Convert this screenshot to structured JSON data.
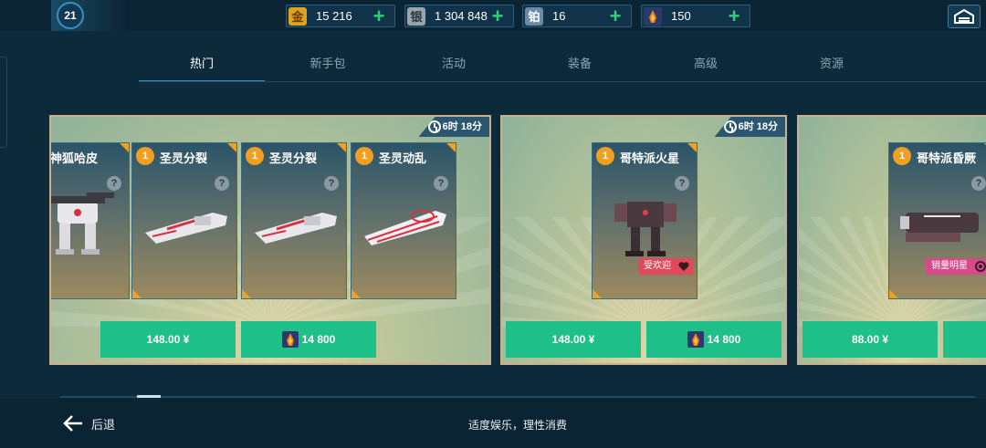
{
  "topbar": {
    "level": "21",
    "resources": [
      {
        "icon": "gold-icon",
        "glyph": "金",
        "value": "15 216",
        "color": "#e0a020"
      },
      {
        "icon": "silver-icon",
        "glyph": "银",
        "value": "1 304 848",
        "color": "#9aa4ac"
      },
      {
        "icon": "platinum-icon",
        "glyph": "铂",
        "value": "16",
        "color": "#6a8aa8"
      },
      {
        "icon": "key-token-icon",
        "glyph": "",
        "value": "150",
        "color": "#e05a30"
      }
    ],
    "home_icon": "hangar-icon"
  },
  "tabs": [
    "热门",
    "新手包",
    "活动",
    "装备",
    "高级",
    "资源"
  ],
  "active_tab": 0,
  "offers": [
    {
      "timer": "6时 18分",
      "cards": [
        {
          "qty": "",
          "name": "神狐哈皮"
        },
        {
          "qty": "1",
          "name": "圣灵分裂"
        },
        {
          "qty": "1",
          "name": "圣灵分裂"
        },
        {
          "qty": "1",
          "name": "圣灵动乱"
        }
      ],
      "buttons": [
        {
          "label": "148.00 ¥",
          "icon": ""
        },
        {
          "label": "14 800",
          "icon": "key-token-icon"
        }
      ]
    },
    {
      "timer": "6时 18分",
      "cards": [
        {
          "qty": "1",
          "name": "哥特派火星",
          "tag": "受欢迎"
        }
      ],
      "buttons": [
        {
          "label": "148.00 ¥",
          "icon": ""
        },
        {
          "label": "14 800",
          "icon": "key-token-icon"
        }
      ]
    },
    {
      "timer": "",
      "cards": [
        {
          "qty": "1",
          "name": "哥特派昏厥",
          "tag": "销量明星"
        }
      ],
      "buttons": [
        {
          "label": "88.00 ¥",
          "icon": ""
        }
      ]
    }
  ],
  "footer": {
    "back_label": "后退",
    "notice": "适度娱乐，理性消费"
  },
  "colors": {
    "accent": "#1fbf8a",
    "highlight": "#f0a020",
    "tab_active": "#3a8fc4"
  }
}
